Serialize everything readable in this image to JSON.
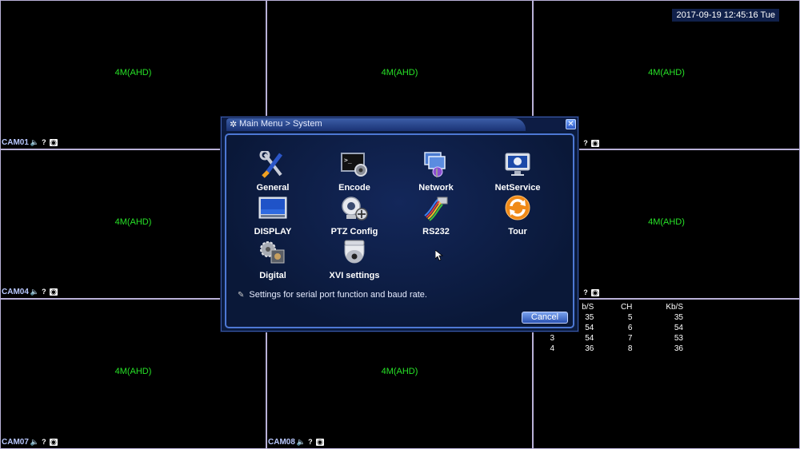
{
  "datetime": "2017-09-19 12:45:16 Tue",
  "cells": [
    {
      "res": "4M(AHD)",
      "cam": "CAM01"
    },
    {
      "res": "4M(AHD)",
      "cam": ""
    },
    {
      "res": "4M(AHD)",
      "cam": ""
    },
    {
      "res": "4M(AHD)",
      "cam": "CAM04"
    },
    {
      "res": "",
      "cam": ""
    },
    {
      "res": "4M(AHD)",
      "cam": ""
    },
    {
      "res": "4M(AHD)",
      "cam": "CAM07"
    },
    {
      "res": "4M(AHD)",
      "cam": "CAM08"
    },
    {
      "res": "",
      "cam": ""
    }
  ],
  "bitrate": {
    "headers": [
      "b/S",
      "CH",
      "Kb/S"
    ],
    "rows": [
      [
        "",
        "35",
        "5",
        "35"
      ],
      [
        "",
        "54",
        "6",
        "54"
      ],
      [
        "3",
        "54",
        "7",
        "53"
      ],
      [
        "4",
        "36",
        "8",
        "36"
      ]
    ]
  },
  "dialog": {
    "title": "Main Menu > System",
    "items": [
      {
        "label": "General",
        "icon": "tools-icon"
      },
      {
        "label": "Encode",
        "icon": "terminal-gear-icon"
      },
      {
        "label": "Network",
        "icon": "network-icon"
      },
      {
        "label": "NetService",
        "icon": "netservice-monitor-icon"
      },
      {
        "label": "DISPLAY",
        "icon": "display-icon"
      },
      {
        "label": "PTZ Config",
        "icon": "ptz-camera-icon"
      },
      {
        "label": "RS232",
        "icon": "serial-cable-icon"
      },
      {
        "label": "Tour",
        "icon": "tour-refresh-icon"
      },
      {
        "label": "Digital",
        "icon": "digital-gears-icon"
      },
      {
        "label": "XVI settings",
        "icon": "dome-camera-icon"
      }
    ],
    "hint": "Settings for serial port function and baud rate.",
    "cancel": "Cancel"
  }
}
